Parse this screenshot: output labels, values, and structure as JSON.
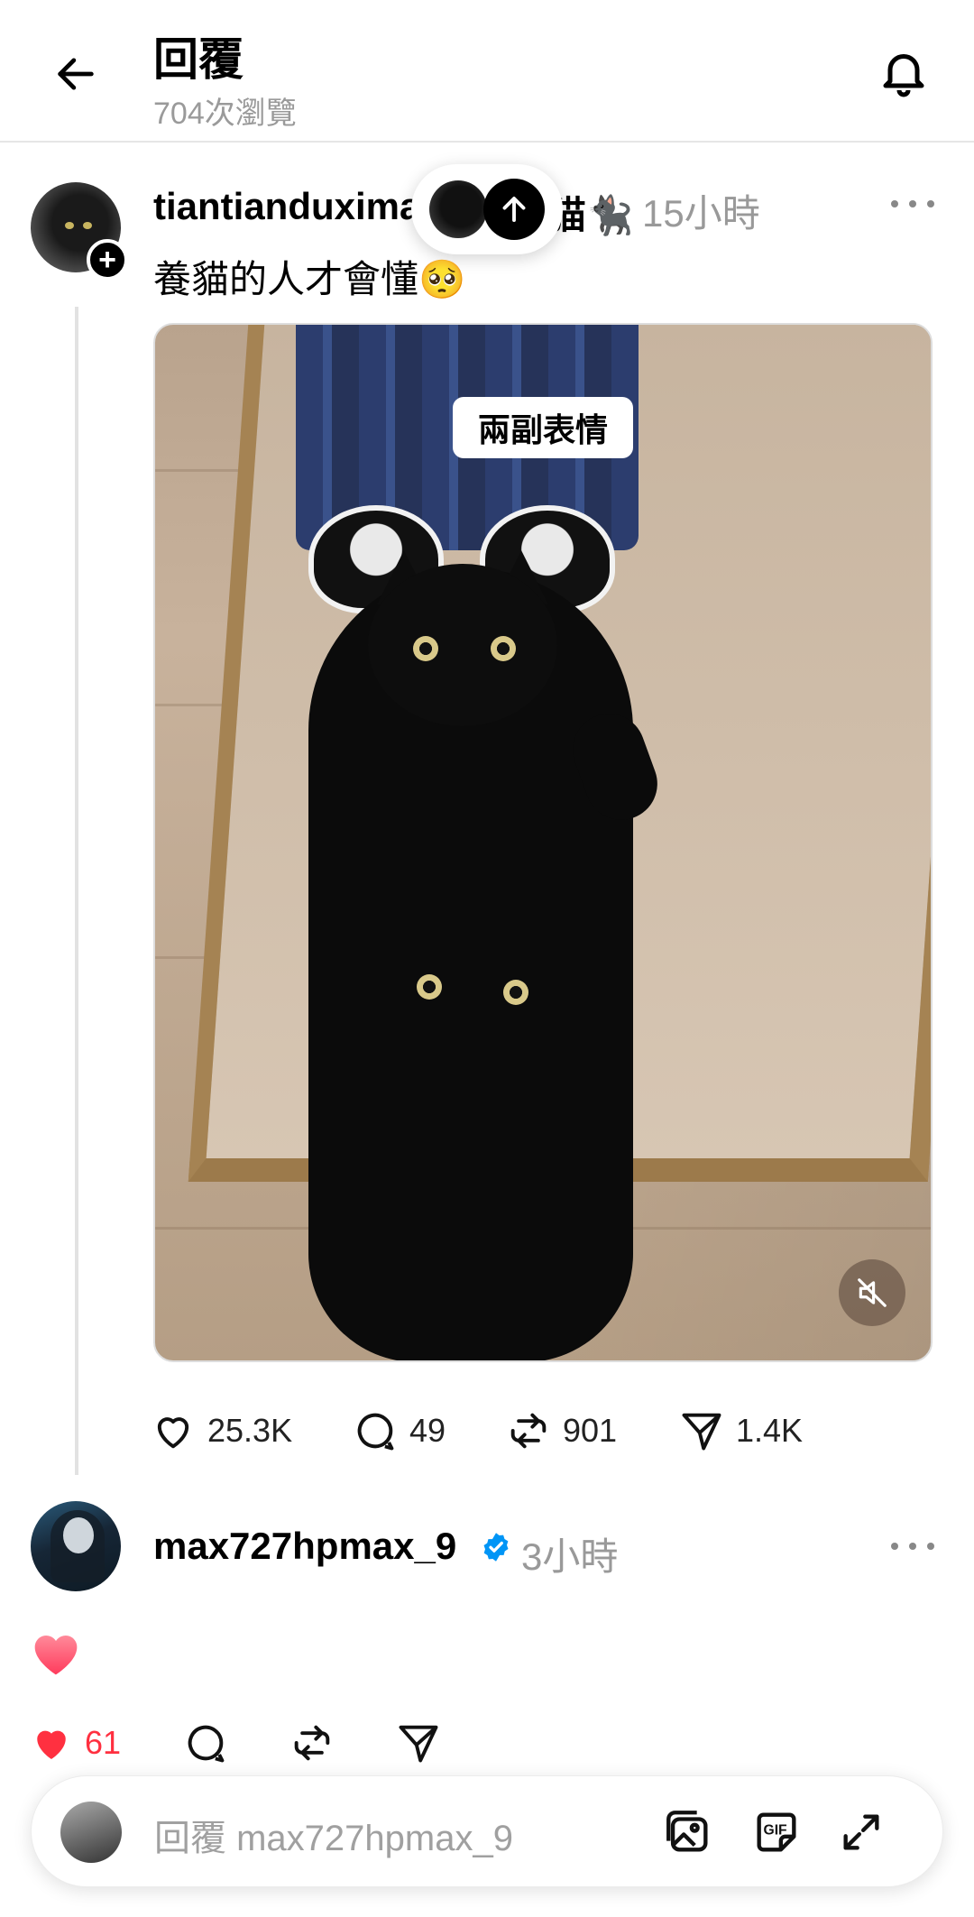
{
  "header": {
    "title": "回覆",
    "views": "704次瀏覽"
  },
  "post": {
    "username": "tiantianduxima",
    "name_suffix": "猫🐈‍⬛",
    "time": "15小時",
    "caption": "養貓的人才會懂🥺",
    "media_label": "兩副表情",
    "stats": {
      "likes": "25.3K",
      "comments": "49",
      "reposts": "901",
      "shares": "1.4K"
    }
  },
  "reply": {
    "username": "max727hpmax_9",
    "time": "3小時",
    "content": "❤️",
    "likes": "61"
  },
  "composer": {
    "placeholder": "回覆 max727hpmax_9"
  },
  "colors": {
    "like_red": "#ff3040",
    "verified_blue": "#0095f6",
    "muted_text": "#999999"
  }
}
